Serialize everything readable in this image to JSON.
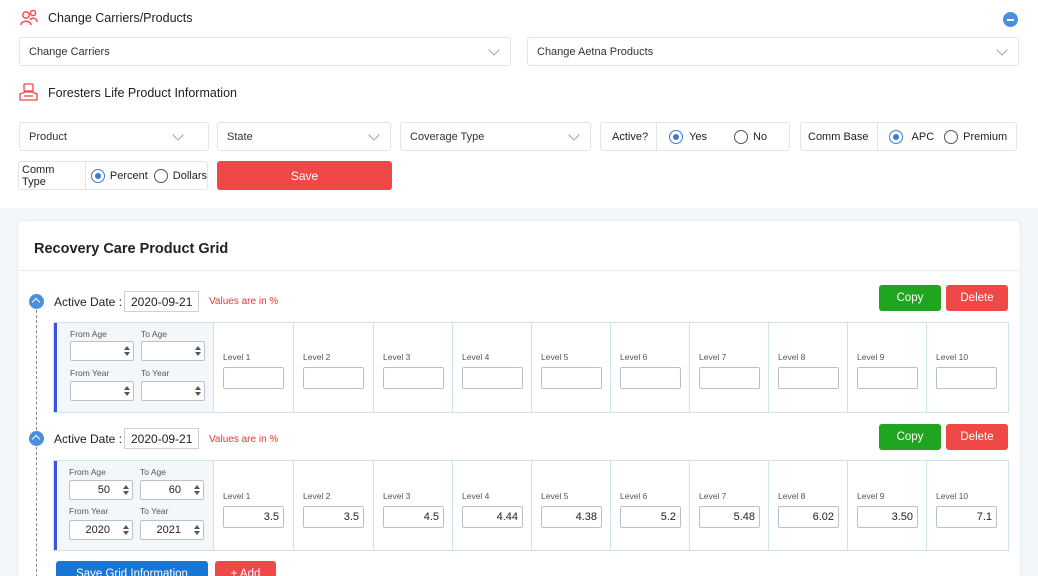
{
  "header": {
    "title": "Change Carriers/Products",
    "change_carriers": "Change Carriers",
    "change_products": "Change Aetna Products"
  },
  "product_info": {
    "title": "Foresters Life Product Information",
    "product": "Product",
    "state": "State",
    "coverage_type": "Coverage Type",
    "active_label": "Active?",
    "active_yes": "Yes",
    "active_no": "No",
    "comm_base_label": "Comm Base",
    "comm_base_apc": "APC",
    "comm_base_premium": "Premium",
    "comm_type_label": "Comm Type",
    "comm_type_percent": "Percent",
    "comm_type_dollars": "Dollars",
    "save": "Save"
  },
  "grid_card": {
    "title": "Recovery Care Product Grid",
    "active_date_label": "Active Date :",
    "values_note": "Values are in %",
    "copy": "Copy",
    "delete": "Delete",
    "from_age": "From Age",
    "to_age": "To Age",
    "from_year": "From Year",
    "to_year": "To Year",
    "levels": [
      "Level 1",
      "Level 2",
      "Level 3",
      "Level 4",
      "Level 5",
      "Level 6",
      "Level 7",
      "Level 8",
      "Level 9",
      "Level 10"
    ],
    "rows": [
      {
        "active_date": "2020-09-21",
        "from_age": "",
        "to_age": "",
        "from_year": "",
        "to_year": "",
        "values": [
          "",
          "",
          "",
          "",
          "",
          "",
          "",
          "",
          "",
          ""
        ]
      },
      {
        "active_date": "2020-09-21",
        "from_age": "50",
        "to_age": "60",
        "from_year": "2020",
        "to_year": "2021",
        "values": [
          "3.5",
          "3.5",
          "4.5",
          "4.44",
          "4.38",
          "5.2",
          "5.48",
          "6.02",
          "3.50",
          "7.1"
        ]
      }
    ],
    "save_grid": "Save Grid Information",
    "add": "+ Add"
  },
  "colors": {
    "accent_red": "#f04747",
    "accent_green": "#1fa51f",
    "accent_blue": "#1976d2",
    "radio_blue": "#3a7bd5"
  }
}
